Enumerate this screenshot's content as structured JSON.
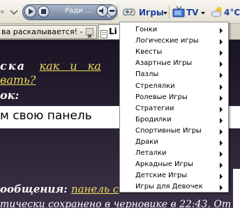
{
  "toolbar": {
    "radio_text": "Ради ...",
    "games_label": "Игры",
    "tv_label": "TV",
    "weather_label": "4°C"
  },
  "tabs": [
    {
      "label": "ва раскалывается! - ..."
    },
    {
      "label": "Li"
    }
  ],
  "content": {
    "line1_prefix": "ска",
    "line1_link": "как и ка",
    "line2_link": "вать?",
    "line3": "ок:",
    "band_text": "м свою панель",
    "line4_prefix": "ообщения:",
    "line4_link": "панель с",
    "line5": "тически сохранено в черновике в 22:43. От"
  },
  "menu": {
    "items": [
      {
        "label": "Гонки"
      },
      {
        "label": "Логические игры"
      },
      {
        "label": "Квесты"
      },
      {
        "label": "Азартные Игры"
      },
      {
        "label": "Пазлы"
      },
      {
        "label": "Стрелялки"
      },
      {
        "label": "Ролевые Игры"
      },
      {
        "label": "Стратегии"
      },
      {
        "label": "Бродилки"
      },
      {
        "label": "Спортивные Игры"
      },
      {
        "label": "Драки"
      },
      {
        "label": "Леталки"
      },
      {
        "label": "Аркадные Игры"
      },
      {
        "label": "Детские Игры"
      },
      {
        "label": "Игры для Девочек"
      }
    ]
  },
  "colors": {
    "toolbar_text": "#1b3fa3",
    "link": "#f0df5a",
    "page_bg": "#2b2236"
  }
}
